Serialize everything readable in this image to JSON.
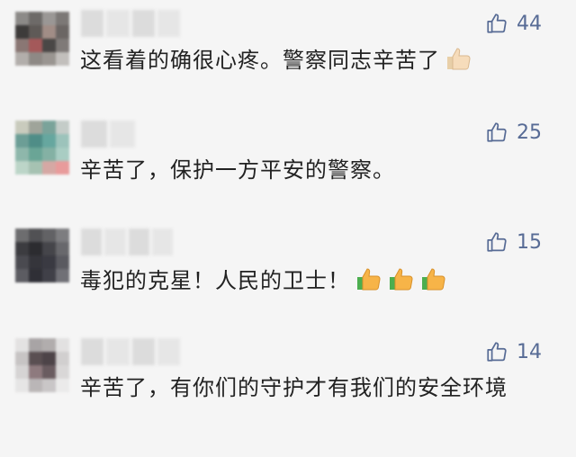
{
  "comments": [
    {
      "likes": "44",
      "text": "这看着的确很心疼。警察同志辛苦了",
      "emoji": [
        "thumbs-up-light"
      ]
    },
    {
      "likes": "25",
      "text": "辛苦了，保护一方平安的警察。",
      "emoji": []
    },
    {
      "likes": "15",
      "text": "毒犯的克星！人民的卫士！",
      "emoji": [
        "thumbs-up",
        "thumbs-up",
        "thumbs-up"
      ]
    },
    {
      "likes": "14",
      "text": "辛苦了，有你们的守护才有我们的安全环境",
      "emoji": []
    }
  ],
  "colors": {
    "like": "#576b95",
    "text": "#222222",
    "background": "#f5f5f5"
  },
  "icons": {
    "like": "thumbs-up-outline-icon"
  }
}
